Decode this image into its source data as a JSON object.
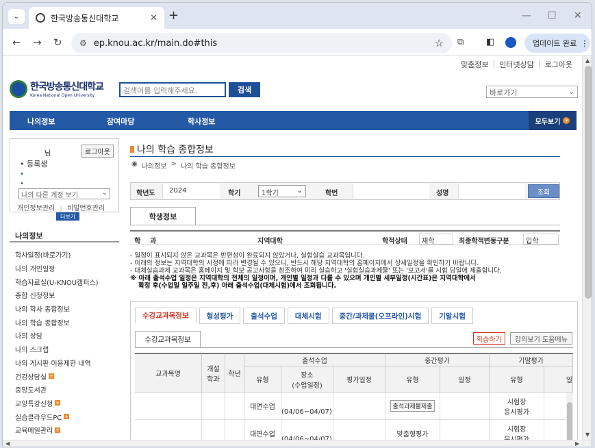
{
  "browser": {
    "tab_title": "한국방송통신대학교",
    "url": "ep.knou.ac.kr/main.do#this",
    "update_label": "업데이트 완료"
  },
  "utility_links": [
    "맞춤정보",
    "인터넷상담",
    "로그아웃"
  ],
  "header": {
    "logo_ko": "한국방송통신대학교",
    "logo_en": "Korea National Open University",
    "search_placeholder": "검색어를 입력해주세요.",
    "search_button": "검색",
    "goto_label": "바로가기"
  },
  "main_nav": {
    "items": [
      "나의정보",
      "참여마당",
      "학사정보"
    ],
    "all_label": "모두보기"
  },
  "user_box": {
    "suffix": "님",
    "logout": "로그아웃",
    "status": "• 등록생",
    "bullet": "•",
    "other_account": "나의 다른 계정 보기",
    "link1": "개인정보관리",
    "link2": "비밀번호관리",
    "more": "더보기"
  },
  "side": {
    "heading": "나의정보",
    "items": [
      {
        "label": "학사일정(바로가기)",
        "plus": false
      },
      {
        "label": "나의 개인일정",
        "plus": false
      },
      {
        "label": "학습자료실(U-KNOU캠퍼스)",
        "plus": false
      },
      {
        "label": "종합 신청정보",
        "plus": false
      },
      {
        "label": "나의 학사 종합정보",
        "plus": false
      },
      {
        "label": "나의 학습 종합정보",
        "plus": false
      },
      {
        "label": "나의 상담",
        "plus": false
      },
      {
        "label": "나의 스크랩",
        "plus": false
      },
      {
        "label": "나의 게시판 이용제한 내역",
        "plus": false
      },
      {
        "label": "건강상담실",
        "plus": true
      },
      {
        "label": "중앙도서관",
        "plus": false
      },
      {
        "label": "교양특강신청",
        "plus": true
      },
      {
        "label": "실습클라우드PC",
        "plus": true
      },
      {
        "label": "교육메일관리",
        "plus": true
      }
    ]
  },
  "content": {
    "title": "나의 학습 종합정보",
    "crumb1": "나의정보",
    "crumb_sep": ">",
    "crumb2": "나의 학습 종합정보",
    "filter": {
      "year_label": "학년도",
      "year_value": "2024",
      "term_label": "학기",
      "term_value": "1학기",
      "id_label": "학번",
      "name_label": "성명",
      "query_button": "조회"
    },
    "student_tab": "학생정보",
    "info": {
      "dept_label": "학    과",
      "region_label": "지역대학",
      "status_label": "학적상태",
      "status_value": "재학",
      "change_label": "최종학적변동구분",
      "change_value": "입학"
    },
    "notices": [
      "- 일정이 표시되지 않은 교과목은 반편성이 완료되지 않았거나, 실험실습 교과목입니다.",
      "- 아래의 정보는 지역대학의 사정에 따라 변경될 수 있으니, 반드시 해당 지역대학의 홈페이지에서 상세일정을 확인하기 바랍니다.",
      "- 대체실습과제 교과목은 홈페이지 및 학보 공고사항을 참조하여 미리 실습하고 '실험실습과제물' 또는 '보고서'를 시험 당일에 제출합니다."
    ],
    "notice_em_1": "※ 아래 출석수업 일정은 지역대학의 전체의 일정이며, 개인별 일정과 다를 수 있으며 개인별 세부일정(시간표)은 지역대학에서",
    "notice_em_2": "확정 후(수업일 일주일 전,후) 아래 출석수업(대체시험)에서 조회됩니다.",
    "course_tabs": [
      "수강교과목정보",
      "형성평가",
      "출석수업",
      "대체시험",
      "중간/과제물(오프라인)시험",
      "기말시험"
    ],
    "inner_tab": "수강교과목정보",
    "btn_study": "학습하기",
    "btn_help": "강의보기 도움메뉴",
    "grid": {
      "h_course": "교과목명",
      "h_grade": "개설\n학과",
      "h_year": "학년",
      "h_attend": "출석수업",
      "h_mid": "중간평가",
      "h_final": "기말평가",
      "h_type": "유형",
      "h_place": "장소\n(수업일정)",
      "h_eval": "평가일정",
      "h_mtype": "유형",
      "h_mdate": "일정",
      "h_ftype": "유형",
      "h_fcut": "일",
      "rows": [
        {
          "type": "대면수업",
          "place": "(04/06~04/07)",
          "mtype": "출석과제물제출",
          "ftype": "시험장\n응시평가"
        },
        {
          "type": "대면수업",
          "place": "(04/06~04/07)",
          "mtype": "맞춤형평가",
          "ftype": "시험장\n응시평가"
        }
      ]
    }
  }
}
